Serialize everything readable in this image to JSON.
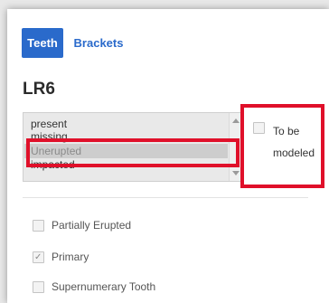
{
  "tabs": [
    {
      "label": "Teeth",
      "active": true
    },
    {
      "label": "Brackets",
      "active": false
    }
  ],
  "tooth_title": "LR6",
  "status_list": {
    "options": [
      "present",
      "missing",
      "Unerupted",
      "impacted"
    ],
    "selected": "Unerupted"
  },
  "to_be_modeled": {
    "label": "To be modeled",
    "checked": false
  },
  "checkboxes": [
    {
      "label": "Partially Erupted",
      "checked": false
    },
    {
      "label": "Primary",
      "checked": true
    },
    {
      "label": "Supernumerary Tooth",
      "checked": false
    }
  ],
  "icons": {
    "check": "checkmark-icon",
    "scroll_up": "scroll-up-arrow-icon",
    "scroll_down": "scroll-down-arrow-icon"
  },
  "colors": {
    "accent": "#2a6acb",
    "highlight_box": "#e0102a"
  }
}
